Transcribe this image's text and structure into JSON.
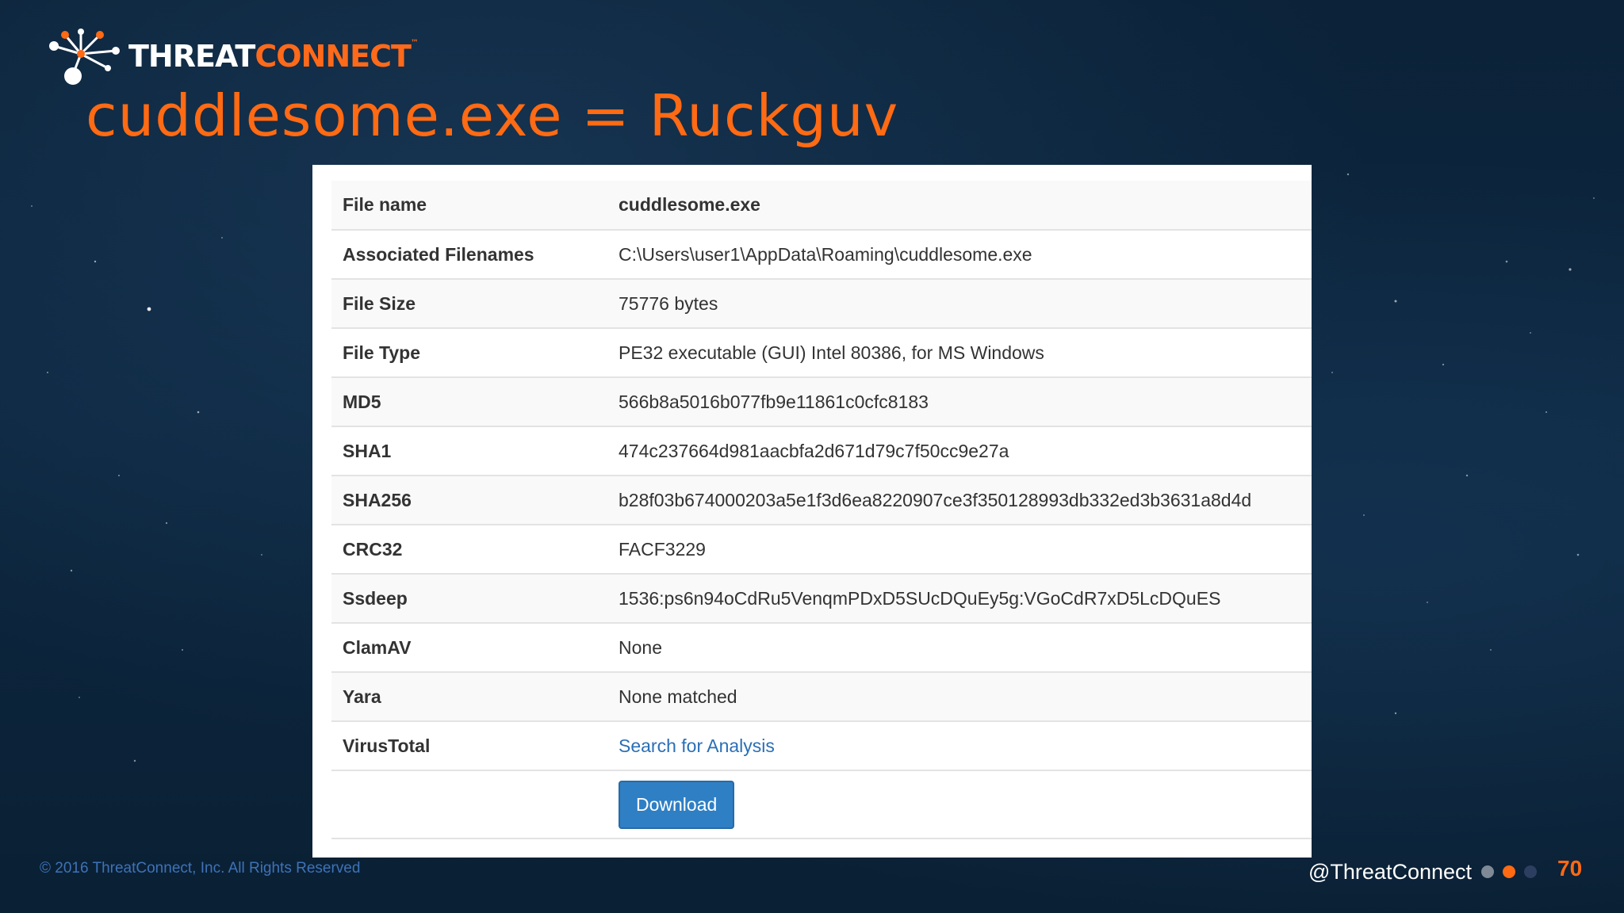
{
  "logo": {
    "part1": "THREAT",
    "part2": "CONNECT",
    "tm": "™",
    "icon": "threatconnect-logo-icon"
  },
  "slide_title": "cuddlesome.exe = Ruckguv",
  "file_details": {
    "rows": [
      {
        "label": "File name",
        "value": "cuddlesome.exe"
      },
      {
        "label": "Associated Filenames",
        "value": "C:\\Users\\user1\\AppData\\Roaming\\cuddlesome.exe"
      },
      {
        "label": "File Size",
        "value": "75776 bytes"
      },
      {
        "label": "File Type",
        "value": "PE32 executable (GUI) Intel 80386, for MS Windows"
      },
      {
        "label": "MD5",
        "value": "566b8a5016b077fb9e11861c0cfc8183"
      },
      {
        "label": "SHA1",
        "value": "474c237664d981aacbfa2d671d79c7f50cc9e27a"
      },
      {
        "label": "SHA256",
        "value": "b28f03b674000203a5e1f3d6ea8220907ce3f350128993db332ed3b3631a8d4d"
      },
      {
        "label": "CRC32",
        "value": "FACF3229"
      },
      {
        "label": "Ssdeep",
        "value": "1536:ps6n94oCdRu5VenqmPDxD5SUcDQuEy5g:VGoCdR7xD5LcDQuES"
      },
      {
        "label": "ClamAV",
        "value": "None"
      },
      {
        "label": "Yara",
        "value": "None matched"
      },
      {
        "label": "VirusTotal",
        "value": "Search for Analysis"
      }
    ],
    "download_label": "Download"
  },
  "footer": {
    "copyright": "© 2016 ThreatConnect, Inc. All Rights Reserved",
    "handle": "@ThreatConnect",
    "page_number": "70"
  },
  "colors": {
    "accent": "#ff6a13",
    "link": "#2a6fb6",
    "button": "#2f7fc4",
    "background": "#0d2740"
  }
}
